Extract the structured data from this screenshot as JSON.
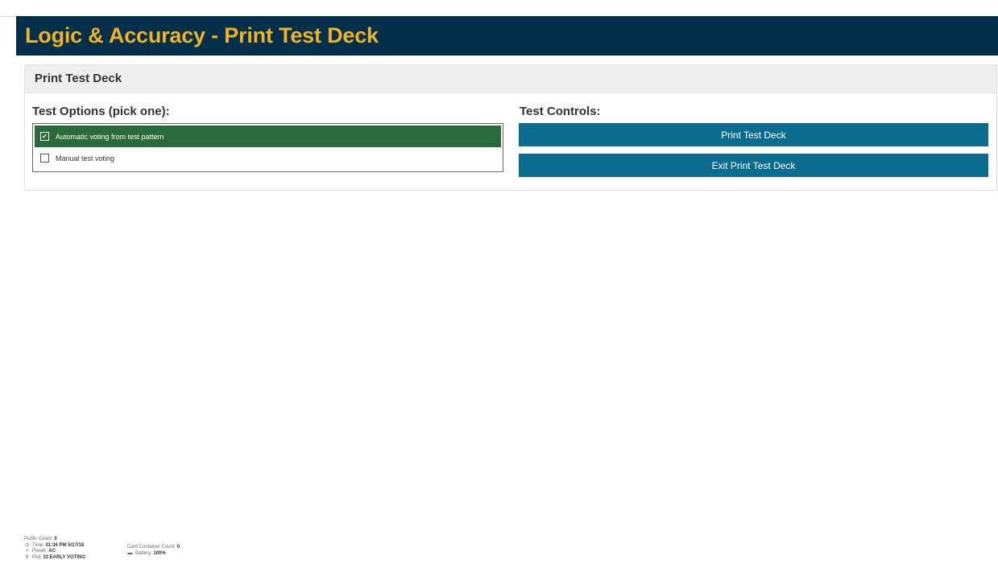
{
  "header": {
    "title": "Logic & Accuracy - Print Test Deck"
  },
  "panel": {
    "title": "Print Test Deck"
  },
  "test_options": {
    "title": "Test Options (pick one):",
    "items": [
      {
        "label": "Automatic voting from test pattern",
        "checked": true
      },
      {
        "label": "Manual test voting",
        "checked": false
      }
    ]
  },
  "test_controls": {
    "title": "Test Controls:",
    "print_label": "Print Test Deck",
    "exit_label": "Exit Print Test Deck"
  },
  "status": {
    "public_count_label": "Public Count:",
    "public_count": "0",
    "time_label": "Time:",
    "time": "01:36 PM 5/17/18",
    "power_label": "Power:",
    "power": "AC",
    "poll_label": "Poll:",
    "poll": "33 EARLY VOTING",
    "card_container_label": "Card Container Count:",
    "card_container_count": "0",
    "battery_label": "Battery:",
    "battery": "100%"
  },
  "colors": {
    "header_bg": "#042f4b",
    "header_text": "#f0b323",
    "selected_option": "#2b6a3a",
    "button_bg": "#0c6c8f"
  },
  "icons": [
    "clock-icon",
    "plug-icon",
    "location-icon",
    "battery-icon",
    "checkbox-checked-icon",
    "checkbox-empty-icon"
  ]
}
